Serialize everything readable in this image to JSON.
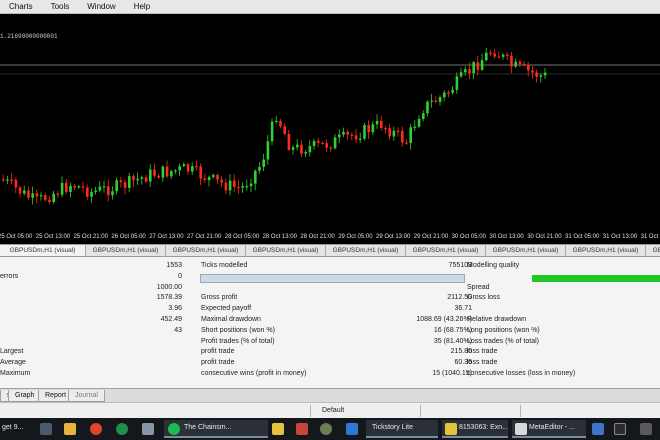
{
  "menu": [
    "Charts",
    "Tools",
    "Window",
    "Help"
  ],
  "chart": {
    "price_label": "1.21690000000001",
    "time_labels": [
      "25 Oct 05:00",
      "25 Oct 13:00",
      "25 Oct 21:00",
      "26 Oct 05:00",
      "27 Oct 13:00",
      "27 Oct 21:00",
      "28 Oct 05:00",
      "28 Oct 13:00",
      "28 Oct 21:00",
      "29 Oct 05:00",
      "29 Oct 13:00",
      "29 Oct 21:00",
      "30 Oct 05:00",
      "30 Oct 13:00",
      "30 Oct 21:00",
      "31 Oct 05:00",
      "31 Oct 13:00",
      "31 Oct 21:00"
    ],
    "bull_color": "#2fd12f",
    "bear_color": "#ff2a1a"
  },
  "symbol_tabs": [
    "GBPUSDm,H1 (visual)",
    "GBPUSDm,H1 (visual)",
    "GBPUSDm,H1 (visual)",
    "GBPUSDm,H1 (visual)",
    "GBPUSDm,H1 (visual)",
    "GBPUSDm,H1 (visual)",
    "GBPUSDm,H1 (visual)",
    "GBPUSDm,H1 (visual)",
    "GBPUSDm,H1 (visual)"
  ],
  "report": {
    "row0": {
      "c1": "",
      "c2": "1553",
      "c3": "Ticks modelled",
      "c4": "755103",
      "c5": "Modelling quality"
    },
    "row1": {
      "c1": "errors",
      "c2": "0",
      "c3": "",
      "c4": "",
      "c5": ""
    },
    "row2": {
      "c1": "",
      "c2": "1000.00",
      "c3": "",
      "c4": "",
      "c5": "Spread"
    },
    "row3": {
      "c1": "",
      "c2": "1578.39",
      "c3": "Gross profit",
      "c4": "2112.50",
      "c5": "Gross loss"
    },
    "row4": {
      "c1": "",
      "c2": "3.96",
      "c3": "Expected payoff",
      "c4": "36.71",
      "c5": ""
    },
    "row5": {
      "c1": "",
      "c2": "452.49",
      "c3": "Maximal drawdown",
      "c4": "1088.69 (43.26%)",
      "c5": "Relative drawdown"
    },
    "row6": {
      "c1": "",
      "c2": "43",
      "c3": "Short positions (won %)",
      "c4": "16 (68.75%)",
      "c5": "Long positions (won %)"
    },
    "row7": {
      "c1": "",
      "c2": "",
      "c3": "Profit trades (% of total)",
      "c4": "35 (81.40%)",
      "c5": "Loss trades (% of total)"
    },
    "row8": {
      "c1": "Largest",
      "c2": "",
      "c3": "profit trade",
      "c4": "215.80",
      "c5": "loss trade"
    },
    "row9": {
      "c1": "Average",
      "c2": "",
      "c3": "profit trade",
      "c4": "60.36",
      "c5": "loss trade"
    },
    "row10": {
      "c1": "Maximum",
      "c2": "",
      "c3": "consecutive wins (profit in money)",
      "c4": "15 (1040.15)",
      "c5": "consecutive losses (loss in money)"
    }
  },
  "tester_tabs": [
    "s",
    "Graph",
    "Report",
    "Journal"
  ],
  "status": {
    "text": "Default"
  },
  "taskbar": {
    "search_partial": "get 9...",
    "spotify": "The Chainsm...",
    "tickstory": "Tickstory Lite",
    "mt": "8153063: Exn...",
    "metaeditor": "MetaEditor - ..."
  }
}
